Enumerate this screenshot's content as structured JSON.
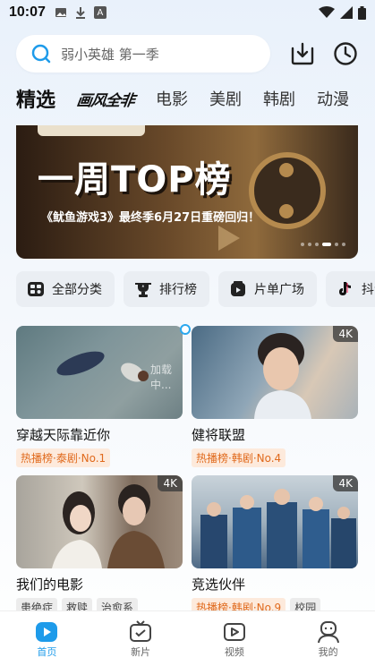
{
  "status_bar": {
    "time": "10:07",
    "sim_label": "A"
  },
  "search": {
    "placeholder": "弱小英雄 第一季"
  },
  "tabs": [
    {
      "label": "精选",
      "active": true
    },
    {
      "label": "画风全非",
      "logo": true
    },
    {
      "label": "电影"
    },
    {
      "label": "美剧"
    },
    {
      "label": "韩剧"
    },
    {
      "label": "动漫"
    }
  ],
  "banner": {
    "headline": "一周TOP榜",
    "subtitle": "《鱿鱼游戏3》最终季6月27日重磅回归！",
    "page_count": 6,
    "active_page": 4
  },
  "categories": [
    {
      "label": "全部分类",
      "icon": "grid-icon"
    },
    {
      "label": "排行榜",
      "icon": "trophy-icon"
    },
    {
      "label": "片单广场",
      "icon": "playlist-icon"
    },
    {
      "label": "抖音",
      "icon": "tiktok-icon"
    }
  ],
  "cards": [
    {
      "title": "穿越天际靠近你",
      "tags": [
        {
          "text": "热播榜·泰剧·No.1",
          "hot": true
        }
      ],
      "badge": "",
      "loading_text": "加载中..."
    },
    {
      "title": "健将联盟",
      "tags": [
        {
          "text": "热播榜·韩剧·No.4",
          "hot": true
        }
      ],
      "badge": "4K"
    },
    {
      "title": "我们的电影",
      "tags": [
        {
          "text": "患绝症"
        },
        {
          "text": "救赎"
        },
        {
          "text": "治愈系"
        }
      ],
      "badge": "4K"
    },
    {
      "title": "竞选伙伴",
      "tags": [
        {
          "text": "热播榜·韩剧·No.9",
          "hot": true
        },
        {
          "text": "校园"
        }
      ],
      "badge": "4K"
    }
  ],
  "bottom_nav": [
    {
      "label": "首页",
      "icon": "home-play-icon",
      "active": true
    },
    {
      "label": "新片",
      "icon": "tv-icon"
    },
    {
      "label": "视频",
      "icon": "video-icon"
    },
    {
      "label": "我的",
      "icon": "profile-icon"
    }
  ],
  "colors": {
    "accent": "#1e9bea",
    "hot_tag_text": "#e06a1d",
    "hot_tag_bg": "#fdeadc"
  }
}
